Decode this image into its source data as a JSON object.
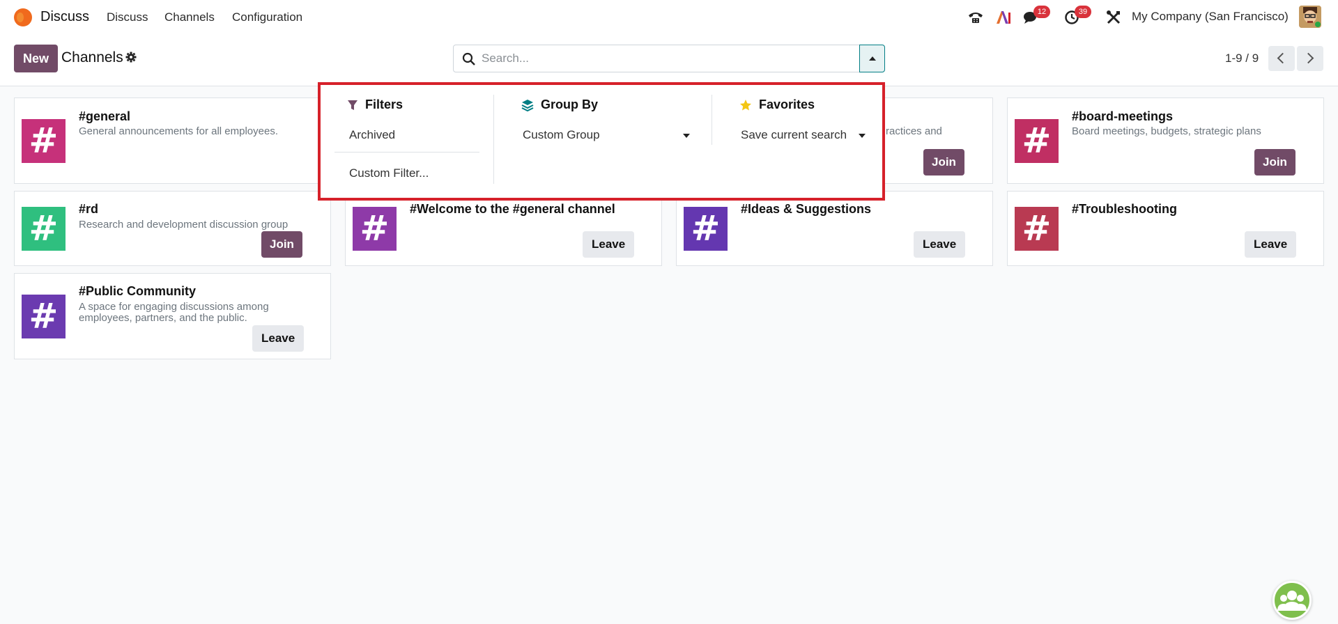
{
  "navbar": {
    "app_name": "Discuss",
    "menu": [
      "Discuss",
      "Channels",
      "Configuration"
    ],
    "messages_badge": "12",
    "activities_badge": "39",
    "company": "My Company (San Francisco)"
  },
  "control_panel": {
    "new_label": "New",
    "title": "Channels",
    "search_placeholder": "Search...",
    "pager": "1-9 / 9"
  },
  "dropdown": {
    "filters": {
      "title": "Filters",
      "items": [
        "Archived",
        "Custom Filter..."
      ]
    },
    "group_by": {
      "title": "Group By",
      "select_value": "Custom Group"
    },
    "favorites": {
      "title": "Favorites",
      "select_value": "Save current search"
    }
  },
  "channels": [
    {
      "name": "#general",
      "description": "General announcements for all employees.",
      "color": "#c6317a",
      "action": ""
    },
    {
      "name": "",
      "description": "",
      "color": "",
      "action": ""
    },
    {
      "name": "",
      "description": "ractices and",
      "color": "",
      "action": "Join"
    },
    {
      "name": "#board-meetings",
      "description": "Board meetings, budgets, strategic plans",
      "color": "#c02f63",
      "action": "Join"
    },
    {
      "name": "#rd",
      "description": "Research and development discussion group",
      "color": "#2fbf7f",
      "action": "Join"
    },
    {
      "name": "#Welcome to the #general channel",
      "description": "",
      "color": "#8e3aa8",
      "action": "Leave"
    },
    {
      "name": "#Ideas & Suggestions",
      "description": "",
      "color": "#6437b0",
      "action": "Leave"
    },
    {
      "name": "#Troubleshooting",
      "description": "",
      "color": "#b93a52",
      "action": "Leave"
    },
    {
      "name": "#Public Community",
      "description": "A space for engaging discussions among employees, partners, and the public.",
      "color": "#6b3bb0",
      "action": "Leave"
    }
  ],
  "icons": {
    "hash": "#"
  },
  "colors": {
    "brand": "#714b67",
    "teal": "#017e84",
    "highlight": "#d6212a"
  }
}
